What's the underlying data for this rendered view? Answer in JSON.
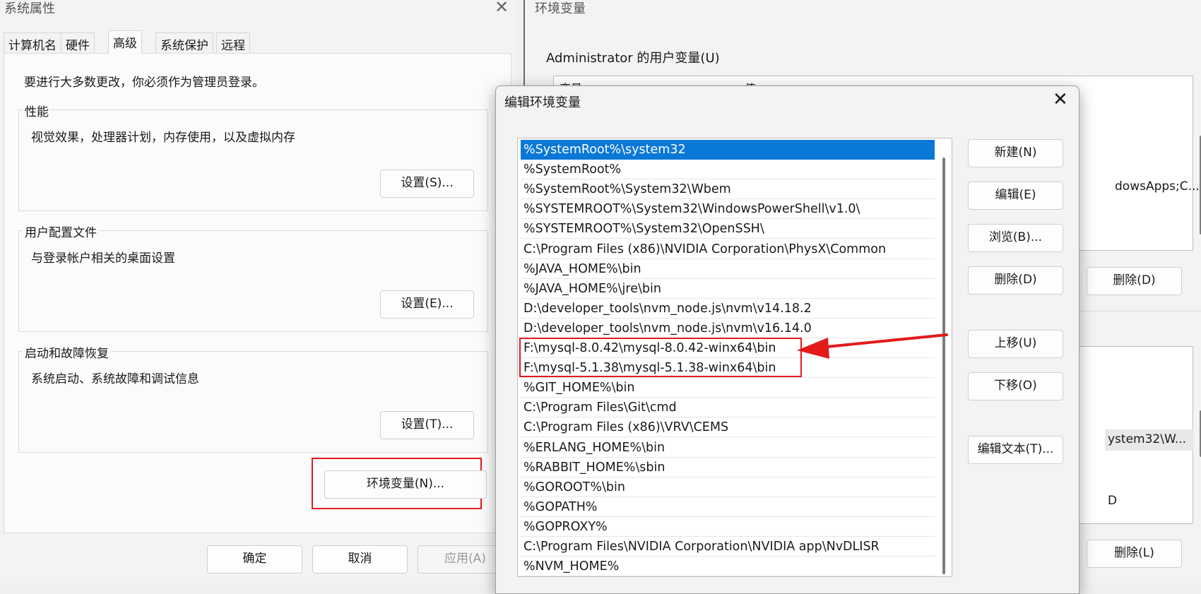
{
  "system_properties": {
    "title": "系统属性",
    "tabs": [
      "计算机名",
      "硬件",
      "高级",
      "系统保护",
      "远程"
    ],
    "active_tab": "高级",
    "admin_note": "要进行大多数更改，你必须作为管理员登录。",
    "groups": [
      {
        "title": "性能",
        "description": "视觉效果，处理器计划，内存使用，以及虚拟内存",
        "button": "设置(S)..."
      },
      {
        "title": "用户配置文件",
        "description": "与登录帐户相关的桌面设置",
        "button": "设置(E)..."
      },
      {
        "title": "启动和故障恢复",
        "description": "系统启动、系统故障和调试信息",
        "button": "设置(T)..."
      }
    ],
    "env_button": "环境变量(N)...",
    "ok": "确定",
    "cancel": "取消",
    "apply": "应用(A)"
  },
  "environment_variables": {
    "title": "环境变量",
    "user_section_label": "Administrator 的用户变量(U)",
    "column_variable": "变量",
    "column_value": "值",
    "partial_value_1": "dowsApps;C...",
    "partial_value_2": "ystem32\\W...",
    "partial_value_3": "D",
    "delete_user": "删除(D)",
    "delete_system": "删除(L)"
  },
  "edit_dialog": {
    "title": "编辑环境变量",
    "paths": [
      "%SystemRoot%\\system32",
      "%SystemRoot%",
      "%SystemRoot%\\System32\\Wbem",
      "%SYSTEMROOT%\\System32\\WindowsPowerShell\\v1.0\\",
      "%SYSTEMROOT%\\System32\\OpenSSH\\",
      "C:\\Program Files (x86)\\NVIDIA Corporation\\PhysX\\Common",
      "%JAVA_HOME%\\bin",
      "%JAVA_HOME%\\jre\\bin",
      "D:\\developer_tools\\nvm_node.js\\nvm\\v14.18.2",
      "D:\\developer_tools\\nvm_node.js\\nvm\\v16.14.0",
      "F:\\mysql-8.0.42\\mysql-8.0.42-winx64\\bin",
      "F:\\mysql-5.1.38\\mysql-5.1.38-winx64\\bin",
      "%GIT_HOME%\\bin",
      "C:\\Program Files\\Git\\cmd",
      "C:\\Program Files (x86)\\VRV\\CEMS",
      "%ERLANG_HOME%\\bin",
      "%RABBIT_HOME%\\sbin",
      "%GOROOT%\\bin",
      "%GOPATH%",
      "%GOPROXY%",
      "C:\\Program Files\\NVIDIA Corporation\\NVIDIA app\\NvDLISR",
      "%NVM_HOME%"
    ],
    "selected_index": 0,
    "buttons": {
      "new": "新建(N)",
      "edit": "编辑(E)",
      "browse": "浏览(B)...",
      "delete": "删除(D)",
      "move_up": "上移(U)",
      "move_down": "下移(O)",
      "edit_text": "编辑文本(T)..."
    }
  },
  "colors": {
    "selection": "#0a78d7",
    "annotation_red": "#e31b1b"
  }
}
